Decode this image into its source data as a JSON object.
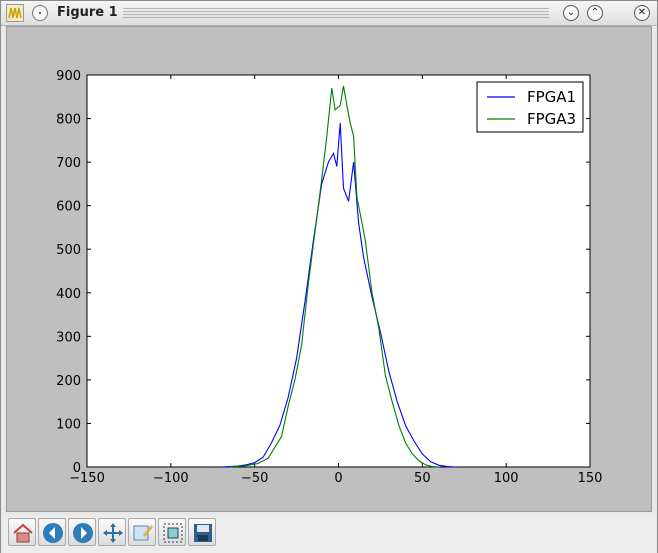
{
  "window": {
    "title": "Figure 1"
  },
  "toolbar": {
    "tools": [
      "home-icon",
      "back-icon",
      "forward-icon",
      "pan-icon",
      "subplots-icon",
      "zoom-icon",
      "save-icon"
    ]
  },
  "chart_data": {
    "type": "line",
    "title": "",
    "xlabel": "",
    "ylabel": "",
    "xlim": [
      -150,
      150
    ],
    "ylim": [
      0,
      900
    ],
    "xticks": [
      "−150",
      "−100",
      "−50",
      "0",
      "50",
      "100",
      "150"
    ],
    "yticks": [
      "0",
      "100",
      "200",
      "300",
      "400",
      "500",
      "600",
      "700",
      "800",
      "900"
    ],
    "legend": {
      "position": "top-right"
    },
    "series": [
      {
        "name": "FPGA1",
        "color": "#0000ff",
        "points": [
          [
            -70,
            0
          ],
          [
            -60,
            2
          ],
          [
            -55,
            5
          ],
          [
            -50,
            10
          ],
          [
            -45,
            22
          ],
          [
            -40,
            55
          ],
          [
            -35,
            95
          ],
          [
            -30,
            160
          ],
          [
            -25,
            250
          ],
          [
            -20,
            380
          ],
          [
            -15,
            520
          ],
          [
            -10,
            650
          ],
          [
            -6,
            700
          ],
          [
            -3,
            720
          ],
          [
            -1,
            690
          ],
          [
            1,
            790
          ],
          [
            3,
            640
          ],
          [
            6,
            610
          ],
          [
            9,
            700
          ],
          [
            12,
            560
          ],
          [
            15,
            480
          ],
          [
            20,
            390
          ],
          [
            25,
            310
          ],
          [
            30,
            220
          ],
          [
            35,
            150
          ],
          [
            40,
            95
          ],
          [
            45,
            60
          ],
          [
            50,
            30
          ],
          [
            55,
            12
          ],
          [
            60,
            4
          ],
          [
            65,
            1
          ],
          [
            70,
            0
          ]
        ]
      },
      {
        "name": "FPGA3",
        "color": "#007f00",
        "points": [
          [
            -65,
            0
          ],
          [
            -55,
            3
          ],
          [
            -48,
            8
          ],
          [
            -42,
            20
          ],
          [
            -38,
            45
          ],
          [
            -34,
            70
          ],
          [
            -30,
            140
          ],
          [
            -26,
            200
          ],
          [
            -22,
            280
          ],
          [
            -18,
            420
          ],
          [
            -14,
            540
          ],
          [
            -10,
            660
          ],
          [
            -7,
            760
          ],
          [
            -4,
            870
          ],
          [
            -2,
            820
          ],
          [
            1,
            830
          ],
          [
            3,
            875
          ],
          [
            5,
            830
          ],
          [
            7,
            790
          ],
          [
            9,
            760
          ],
          [
            11,
            620
          ],
          [
            13,
            580
          ],
          [
            16,
            520
          ],
          [
            20,
            400
          ],
          [
            24,
            320
          ],
          [
            28,
            210
          ],
          [
            32,
            150
          ],
          [
            36,
            95
          ],
          [
            40,
            55
          ],
          [
            44,
            30
          ],
          [
            48,
            14
          ],
          [
            52,
            5
          ],
          [
            56,
            1
          ],
          [
            60,
            0
          ]
        ]
      }
    ]
  }
}
